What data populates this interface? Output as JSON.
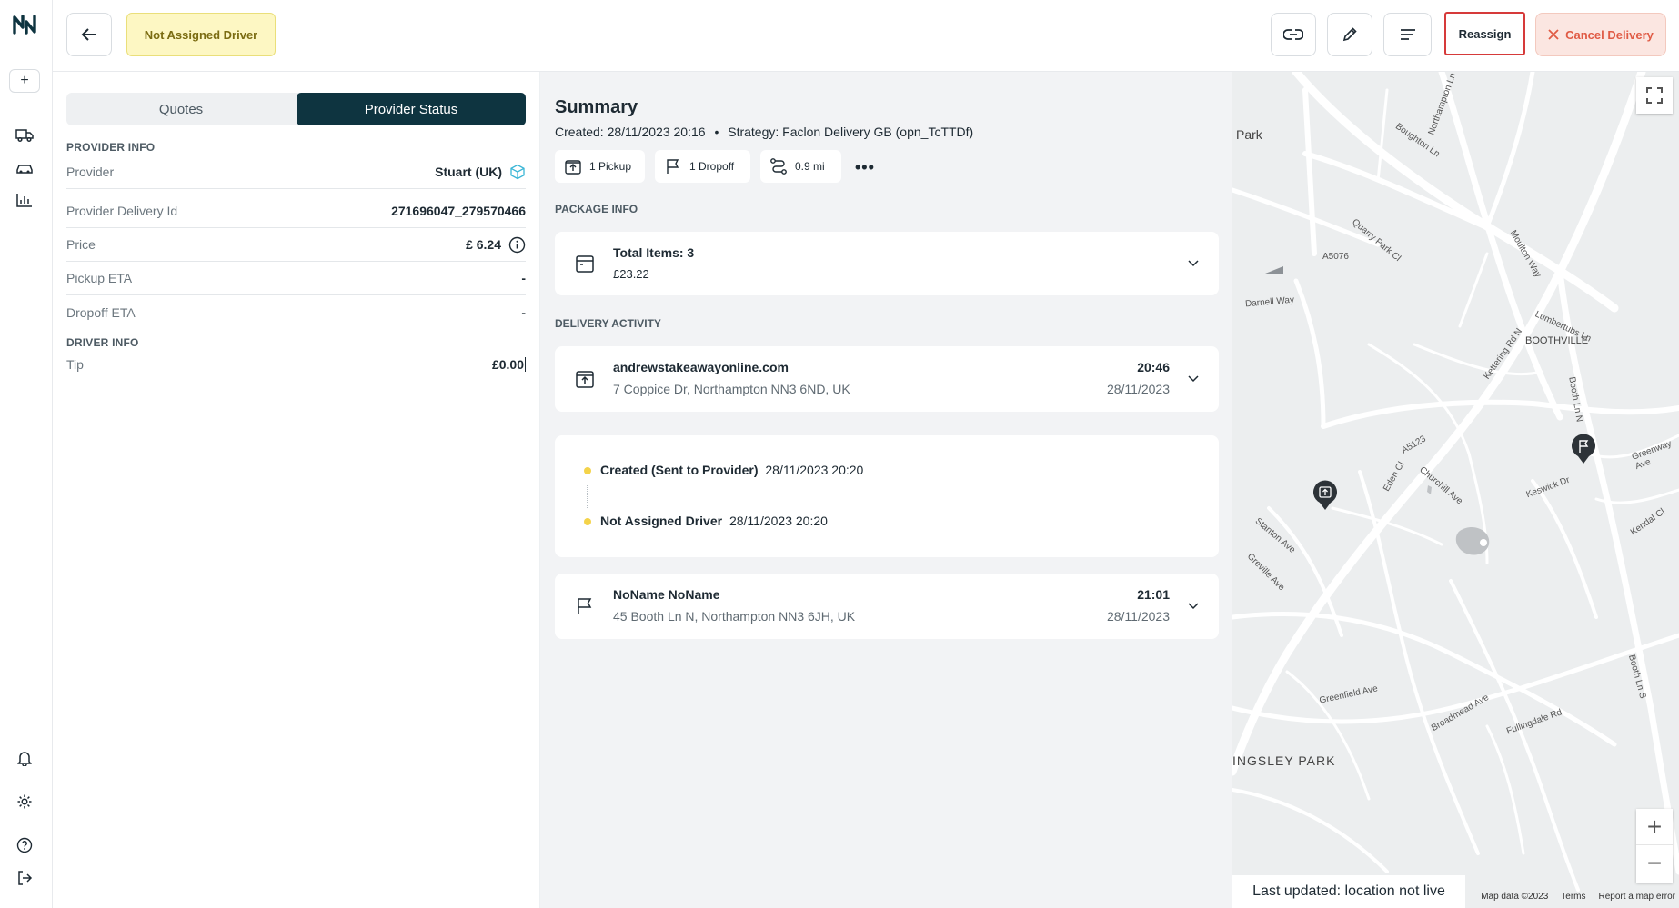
{
  "header": {
    "status": "Not Assigned Driver",
    "reassign_label": "Reassign",
    "cancel_label": "Cancel Delivery"
  },
  "tabs": [
    {
      "label": "Quotes",
      "active": false
    },
    {
      "label": "Provider Status",
      "active": true
    }
  ],
  "provider_info": {
    "heading": "PROVIDER INFO",
    "rows": [
      {
        "label": "Provider",
        "value": "Stuart (UK)"
      },
      {
        "label": "Provider Delivery Id",
        "value": "271696047_279570466"
      },
      {
        "label": "Price",
        "value": "£ 6.24"
      },
      {
        "label": "Pickup ETA",
        "value": "-"
      },
      {
        "label": "Dropoff ETA",
        "value": "-"
      }
    ]
  },
  "driver_info": {
    "heading": "DRIVER INFO",
    "tip_label": "Tip",
    "tip_value": "£0.00"
  },
  "summary": {
    "title": "Summary",
    "created": "Created: 28/11/2023 20:16",
    "strategy": "Strategy: Faclon Delivery GB (opn_TcTTDf)",
    "chips": [
      "1 Pickup",
      "1 Dropoff",
      "0.9 mi"
    ]
  },
  "package": {
    "heading": "PACKAGE INFO",
    "total_items": "Total Items: 3",
    "amount": "£23.22"
  },
  "activity": {
    "heading": "DELIVERY ACTIVITY",
    "pickup": {
      "name": "andrewstakeawayonline.com",
      "address": "7 Coppice Dr, Northampton NN3 6ND, UK",
      "time": "20:46",
      "date": "28/11/2023"
    },
    "timeline": [
      {
        "status": "Created (Sent to Provider)",
        "time": "28/11/2023 20:20"
      },
      {
        "status": "Not Assigned Driver",
        "time": "28/11/2023 20:20"
      }
    ],
    "dropoff": {
      "name": "NoName NoName",
      "address": "45 Booth Ln N, Northampton NN3 6JH, UK",
      "time": "21:01",
      "date": "28/11/2023"
    }
  },
  "map": {
    "last_updated": "Last updated: location not live",
    "attribution": [
      "Map data ©2023",
      "Terms",
      "Report a map error"
    ],
    "labels": [
      "Park",
      "A5076",
      "Boughton Ln",
      "Northampton Ln",
      "Moulton Way",
      "BOOTHVILLE",
      "Kettering Rd N",
      "Booth Ln N",
      "A5123",
      "Greenway Ave",
      "Keswick Dr",
      "Kendal Cl",
      "Stanton Ave",
      "Greville Ave",
      "Eden Cl",
      "Churchill Ave",
      "Greenfield Ave",
      "INGSLEY PARK",
      "Broadmead Ave",
      "Booth Ln S",
      "Fullingdale Rd",
      "Darnell Way",
      "Quarry Park Cl",
      "Lumbertubs Ln"
    ]
  }
}
